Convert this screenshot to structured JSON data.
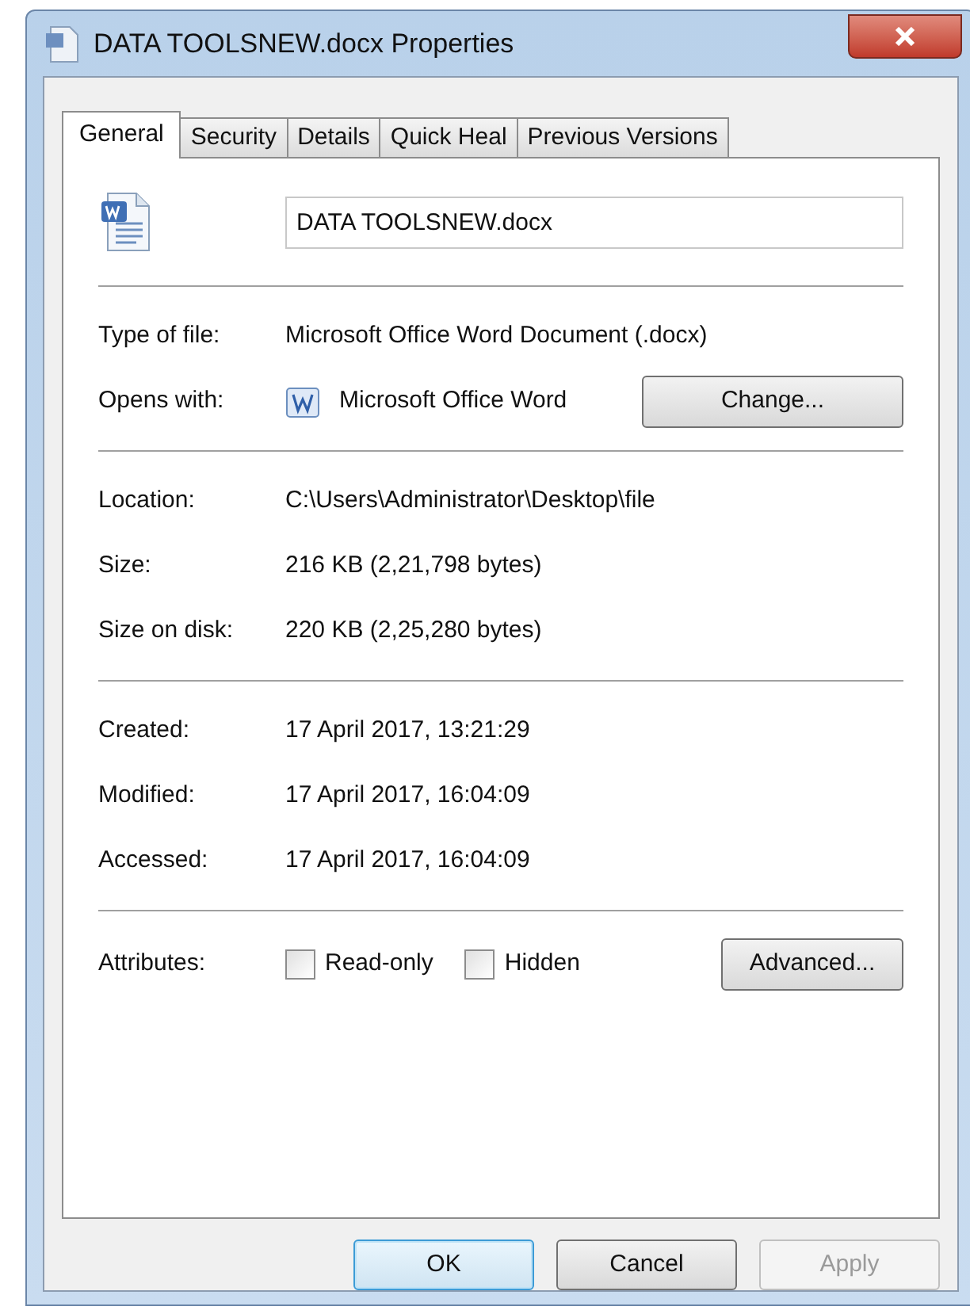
{
  "window": {
    "title": "DATA TOOLSNEW.docx Properties"
  },
  "tabs": [
    {
      "label": "General",
      "selected": true
    },
    {
      "label": "Security",
      "selected": false
    },
    {
      "label": "Details",
      "selected": false
    },
    {
      "label": "Quick Heal",
      "selected": false
    },
    {
      "label": "Previous Versions",
      "selected": false
    }
  ],
  "file_name": {
    "value": "DATA TOOLSNEW.docx"
  },
  "type_section": [
    {
      "kind": "text",
      "label": "Type of file:",
      "value": "Microsoft Office Word Document (.docx)"
    },
    {
      "kind": "app",
      "label": "Opens with:",
      "value": "Microsoft Office Word",
      "button": "Change..."
    }
  ],
  "location_section": [
    {
      "kind": "text",
      "label": "Location:",
      "value": "C:\\Users\\Administrator\\Desktop\\file"
    },
    {
      "kind": "text",
      "label": "Size:",
      "value": "216 KB (2,21,798 bytes)"
    },
    {
      "kind": "text",
      "label": "Size on disk:",
      "value": "220 KB (2,25,280 bytes)"
    }
  ],
  "dates_section": [
    {
      "kind": "text",
      "label": "Created:",
      "value": "17 April 2017, 13:21:29"
    },
    {
      "kind": "text",
      "label": "Modified:",
      "value": "17 April 2017, 16:04:09"
    },
    {
      "kind": "text",
      "label": "Accessed:",
      "value": "17 April 2017, 16:04:09"
    }
  ],
  "attributes": {
    "label": "Attributes:",
    "options": [
      {
        "label": "Read-only",
        "checked": false
      },
      {
        "label": "Hidden",
        "checked": false
      }
    ],
    "button": "Advanced..."
  },
  "buttons": [
    {
      "label": "OK",
      "default": true,
      "disabled": false
    },
    {
      "label": "Cancel",
      "default": false,
      "disabled": false
    },
    {
      "label": "Apply",
      "default": false,
      "disabled": true
    }
  ]
}
